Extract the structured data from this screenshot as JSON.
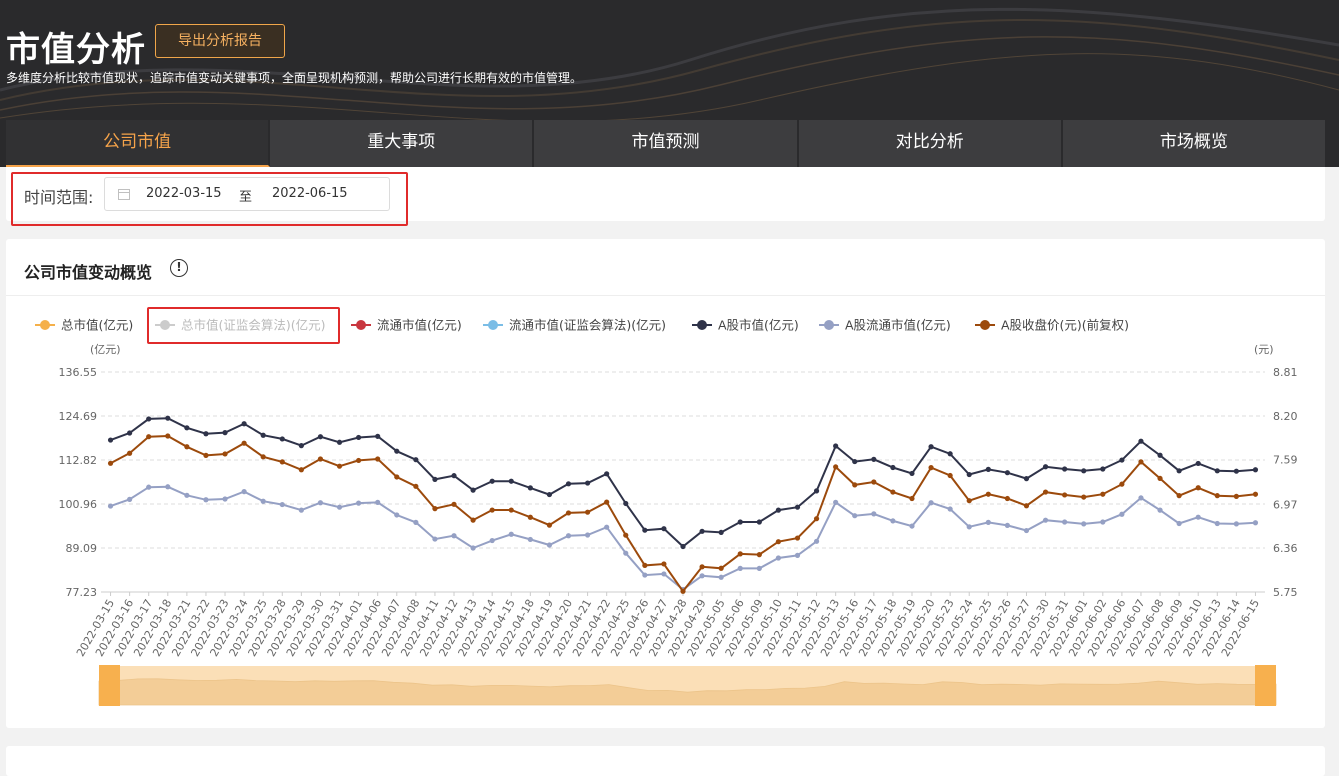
{
  "header": {
    "title": "市值分析",
    "export_label": "导出分析报告",
    "subtitle": "多维度分析比较市值现状，追踪市值变动关键事项，全面呈现机构预测，帮助公司进行长期有效的市值管理。"
  },
  "tabs": [
    {
      "label": "公司市值",
      "active": true
    },
    {
      "label": "重大事项",
      "active": false
    },
    {
      "label": "市值预测",
      "active": false
    },
    {
      "label": "对比分析",
      "active": false
    },
    {
      "label": "市场概览",
      "active": false
    }
  ],
  "filter": {
    "label": "时间范围:",
    "start": "2022-03-15",
    "separator": "至",
    "end": "2022-06-15"
  },
  "chart_panel": {
    "title": "公司市值变动概览",
    "info_icon": "info-circle-icon"
  },
  "chart_data": {
    "type": "line",
    "title": "公司市值变动概览",
    "left_unit": "(亿元)",
    "right_unit": "(元)",
    "y_left_ticks": [
      "136.55",
      "124.69",
      "112.82",
      "100.96",
      "89.09",
      "77.23"
    ],
    "y_right_ticks": [
      "8.81",
      "8.20",
      "7.59",
      "6.97",
      "6.36",
      "5.75"
    ],
    "ylim_left": [
      77.23,
      136.55
    ],
    "ylim_right": [
      5.75,
      8.81
    ],
    "grid": true,
    "legend_position": "top-left",
    "x": [
      "2022-03-15",
      "2022-03-16",
      "2022-03-17",
      "2022-03-18",
      "2022-03-21",
      "2022-03-22",
      "2022-03-23",
      "2022-03-24",
      "2022-03-25",
      "2022-03-28",
      "2022-03-29",
      "2022-03-30",
      "2022-03-31",
      "2022-04-01",
      "2022-04-06",
      "2022-04-07",
      "2022-04-08",
      "2022-04-11",
      "2022-04-12",
      "2022-04-13",
      "2022-04-14",
      "2022-04-15",
      "2022-04-18",
      "2022-04-19",
      "2022-04-20",
      "2022-04-21",
      "2022-04-22",
      "2022-04-25",
      "2022-04-26",
      "2022-04-27",
      "2022-04-28",
      "2022-04-29",
      "2022-05-05",
      "2022-05-06",
      "2022-05-09",
      "2022-05-10",
      "2022-05-11",
      "2022-05-12",
      "2022-05-13",
      "2022-05-16",
      "2022-05-17",
      "2022-05-18",
      "2022-05-19",
      "2022-05-20",
      "2022-05-23",
      "2022-05-24",
      "2022-05-25",
      "2022-05-26",
      "2022-05-27",
      "2022-05-30",
      "2022-05-31",
      "2022-06-01",
      "2022-06-02",
      "2022-06-06",
      "2022-06-07",
      "2022-06-08",
      "2022-06-09",
      "2022-06-10",
      "2022-06-13",
      "2022-06-14",
      "2022-06-15"
    ],
    "series": [
      {
        "name": "总市值(亿元)",
        "color": "#f5b04a",
        "axis": "left",
        "visible": false,
        "values": []
      },
      {
        "name": "总市值(证监会算法)(亿元)",
        "color": "#cccccc",
        "axis": "left",
        "visible": false,
        "disabled": true,
        "values": []
      },
      {
        "name": "流通市值(亿元)",
        "color": "#c9373f",
        "axis": "left",
        "visible": false,
        "values": []
      },
      {
        "name": "流通市值(证监会算法)(亿元)",
        "color": "#7bbde6",
        "axis": "left",
        "visible": false,
        "values": []
      },
      {
        "name": "A股市值(亿元)",
        "color": "#2f3349",
        "axis": "left",
        "visible": true,
        "values": [
          118.2,
          120.1,
          123.9,
          124.1,
          121.5,
          119.9,
          120.2,
          122.6,
          119.5,
          118.5,
          116.7,
          119.1,
          117.6,
          118.9,
          119.2,
          115.2,
          112.9,
          107.6,
          108.6,
          104.7,
          107.1,
          107.1,
          105.3,
          103.5,
          106.4,
          106.6,
          109.1,
          101.1,
          93.9,
          94.3,
          89.5,
          93.6,
          93.3,
          96.1,
          96.1,
          99.3,
          100.1,
          104.5,
          116.6,
          112.4,
          113.0,
          110.8,
          109.2,
          116.4,
          114.5,
          108.9,
          110.3,
          109.4,
          107.8,
          111.0,
          110.4,
          109.9,
          110.4,
          112.8,
          117.9,
          114.1,
          109.9,
          111.9,
          109.9,
          109.8,
          110.2
        ]
      },
      {
        "name": "A股流通市值(亿元)",
        "color": "#95a0c4",
        "axis": "left",
        "visible": true,
        "values": [
          100.4,
          102.2,
          105.5,
          105.6,
          103.3,
          102.1,
          102.3,
          104.3,
          101.7,
          100.8,
          99.3,
          101.3,
          100.1,
          101.2,
          101.4,
          98.0,
          96.0,
          91.5,
          92.4,
          89.1,
          91.1,
          92.8,
          91.4,
          89.9,
          92.4,
          92.6,
          94.7,
          87.7,
          81.8,
          82.1,
          77.9,
          81.6,
          81.2,
          83.6,
          83.6,
          86.4,
          87.1,
          90.9,
          101.4,
          97.8,
          98.3,
          96.4,
          95.0,
          101.3,
          99.6,
          94.8,
          96.0,
          95.2,
          93.8,
          96.6,
          96.1,
          95.6,
          96.1,
          98.2,
          102.6,
          99.3,
          95.7,
          97.4,
          95.7,
          95.6,
          95.9
        ]
      },
      {
        "name": "A股收盘价(元)(前复权)",
        "color": "#9c4a0c",
        "axis": "right",
        "visible": true,
        "values": [
          7.54,
          7.68,
          7.91,
          7.92,
          7.77,
          7.65,
          7.67,
          7.82,
          7.63,
          7.56,
          7.45,
          7.6,
          7.5,
          7.58,
          7.6,
          7.35,
          7.22,
          6.91,
          6.97,
          6.75,
          6.89,
          6.89,
          6.79,
          6.68,
          6.85,
          6.86,
          7.0,
          6.54,
          6.12,
          6.14,
          5.76,
          6.1,
          6.08,
          6.28,
          6.27,
          6.45,
          6.5,
          6.77,
          7.49,
          7.24,
          7.28,
          7.14,
          7.05,
          7.48,
          7.37,
          7.02,
          7.11,
          7.05,
          6.95,
          7.14,
          7.1,
          7.07,
          7.11,
          7.25,
          7.56,
          7.33,
          7.09,
          7.2,
          7.09,
          7.08,
          7.11
        ]
      }
    ]
  }
}
